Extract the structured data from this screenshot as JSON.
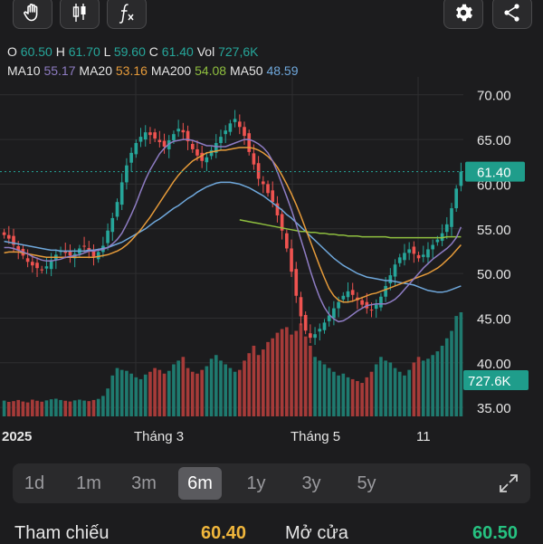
{
  "toolbar": {
    "left_buttons": [
      "hand-icon",
      "candlestick-icon",
      "function-icon"
    ],
    "right_buttons": [
      "gear-icon",
      "share-icon"
    ]
  },
  "ohlc": {
    "o_label": "O",
    "o": "60.50",
    "h_label": "H",
    "h": "61.70",
    "l_label": "L",
    "l": "59.60",
    "c_label": "C",
    "c": "61.40",
    "vol_label": "Vol",
    "vol": "727,6K"
  },
  "ma": {
    "ma10_label": "MA10",
    "ma10": "55.17",
    "ma20_label": "MA20",
    "ma20": "53.16",
    "ma200_label": "MA200",
    "ma200": "54.08",
    "ma50_label": "MA50",
    "ma50": "48.59"
  },
  "colors": {
    "up": "#26a69a",
    "down": "#ef5350",
    "ma10": "#8e7cc3",
    "ma20": "#e69b3a",
    "ma200": "#8fbf3f",
    "ma50": "#6fa8dc",
    "background": "#1c1c1e"
  },
  "chart_data": {
    "type": "candlestick",
    "y_ticks": [
      "70.00",
      "65.00",
      "60.00",
      "55.00",
      "50.00",
      "45.00",
      "40.00",
      "35.00"
    ],
    "ylim": [
      34,
      72
    ],
    "x_ticks": [
      "2025",
      "Tháng 3",
      "Tháng 5",
      "11"
    ],
    "last_price": "61.40",
    "last_volume": "727.6K",
    "close": [
      54.3,
      53.9,
      53.2,
      52.6,
      52.0,
      51.3,
      50.9,
      50.6,
      50.4,
      50.8,
      51.5,
      52.1,
      52.6,
      52.3,
      52.0,
      52.2,
      52.8,
      53.0,
      52.5,
      51.9,
      52.4,
      53.1,
      54.8,
      56.2,
      58.0,
      60.2,
      62.1,
      63.5,
      64.6,
      65.3,
      65.8,
      65.5,
      65.1,
      64.7,
      64.2,
      64.9,
      65.6,
      66.2,
      65.8,
      64.8,
      63.9,
      63.2,
      62.6,
      63.0,
      63.8,
      64.6,
      65.3,
      66.0,
      66.8,
      67.3,
      66.4,
      65.4,
      63.6,
      62.2,
      60.6,
      60.0,
      59.0,
      58.0,
      56.5,
      54.8,
      52.8,
      50.2,
      47.5,
      45.2,
      43.6,
      42.8,
      43.2,
      43.8,
      44.5,
      45.3,
      46.1,
      46.8,
      47.5,
      48.0,
      47.6,
      47.0,
      46.5,
      46.1,
      45.9,
      46.5,
      47.4,
      48.6,
      49.8,
      51.0,
      51.8,
      52.3,
      52.7,
      52.2,
      51.7,
      52.1,
      52.7,
      53.2,
      53.8,
      54.5,
      55.5,
      57.3,
      59.5,
      61.4
    ],
    "ma10": [
      52.9,
      52.9,
      52.8,
      52.6,
      52.4,
      52.2,
      51.9,
      51.7,
      51.5,
      51.4,
      51.4,
      51.5,
      51.6,
      51.8,
      51.9,
      52.0,
      52.1,
      52.3,
      52.5,
      52.5,
      52.6,
      52.7,
      52.9,
      53.3,
      53.8,
      54.5,
      55.5,
      56.6,
      57.8,
      59.2,
      60.5,
      61.6,
      62.5,
      63.4,
      64.0,
      64.5,
      64.8,
      64.9,
      65.0,
      65.0,
      64.9,
      64.7,
      64.5,
      64.3,
      64.3,
      64.2,
      64.2,
      64.2,
      64.4,
      64.6,
      64.8,
      65.0,
      65.0,
      64.8,
      64.5,
      64.1,
      63.5,
      62.6,
      61.4,
      60.0,
      58.6,
      57.1,
      55.5,
      53.8,
      52.1,
      50.3,
      48.7,
      47.3,
      46.2,
      45.4,
      44.9,
      44.6,
      44.7,
      45.0,
      45.4,
      45.8,
      46.1,
      46.4,
      46.5,
      46.6,
      46.6,
      46.6,
      46.8,
      47.1,
      47.6,
      48.2,
      48.8,
      49.4,
      50.0,
      50.6,
      51.1,
      51.6,
      52.0,
      52.4,
      52.8,
      53.3,
      54.0,
      55.2
    ],
    "ma20": [
      52.3,
      52.4,
      52.4,
      52.4,
      52.3,
      52.2,
      52.1,
      52.0,
      51.9,
      51.8,
      51.8,
      51.8,
      51.8,
      51.8,
      51.8,
      51.8,
      51.8,
      51.8,
      51.8,
      51.8,
      51.9,
      52.0,
      52.1,
      52.3,
      52.5,
      52.8,
      53.2,
      53.7,
      54.3,
      54.9,
      55.6,
      56.3,
      57.1,
      57.9,
      58.7,
      59.5,
      60.3,
      61.0,
      61.6,
      62.1,
      62.6,
      62.9,
      63.2,
      63.5,
      63.6,
      63.7,
      63.8,
      63.8,
      63.9,
      64.0,
      64.1,
      64.1,
      64.1,
      64.0,
      63.8,
      63.5,
      63.1,
      62.6,
      61.9,
      61.0,
      60.0,
      58.9,
      57.7,
      56.4,
      55.0,
      53.6,
      52.2,
      50.8,
      49.5,
      48.3,
      47.5,
      47.0,
      46.8,
      46.8,
      46.9,
      47.1,
      47.3,
      47.5,
      47.7,
      47.8,
      48.0,
      48.2,
      48.4,
      48.6,
      48.8,
      49.0,
      49.2,
      49.4,
      49.6,
      49.8,
      50.0,
      50.3,
      50.6,
      51.0,
      51.5,
      52.0,
      52.6,
      53.2
    ],
    "ma50": [
      53.6,
      53.5,
      53.4,
      53.3,
      53.2,
      53.1,
      53.0,
      52.9,
      52.8,
      52.7,
      52.6,
      52.6,
      52.5,
      52.5,
      52.5,
      52.5,
      52.5,
      52.5,
      52.6,
      52.6,
      52.7,
      52.8,
      52.9,
      53.1,
      53.3,
      53.5,
      53.8,
      54.1,
      54.4,
      54.7,
      55.0,
      55.4,
      55.8,
      56.1,
      56.5,
      56.9,
      57.3,
      57.6,
      58.0,
      58.4,
      58.7,
      59.1,
      59.4,
      59.7,
      59.9,
      60.1,
      60.2,
      60.2,
      60.2,
      60.1,
      60.0,
      59.8,
      59.6,
      59.3,
      59.0,
      58.7,
      58.3,
      57.9,
      57.5,
      57.1,
      56.6,
      56.2,
      55.7,
      55.2,
      54.7,
      54.2,
      53.7,
      53.2,
      52.7,
      52.2,
      51.7,
      51.3,
      50.9,
      50.6,
      50.3,
      50.0,
      49.8,
      49.6,
      49.5,
      49.4,
      49.3,
      49.2,
      49.2,
      49.1,
      49.0,
      48.9,
      48.8,
      48.7,
      48.5,
      48.3,
      48.1,
      48.0,
      47.9,
      47.9,
      48.0,
      48.2,
      48.4,
      48.6
    ],
    "ma200_start_index": 50,
    "ma200": [
      56.0,
      55.9,
      55.8,
      55.7,
      55.6,
      55.5,
      55.4,
      55.3,
      55.2,
      55.1,
      55.0,
      54.9,
      54.8,
      54.7,
      54.7,
      54.6,
      54.6,
      54.5,
      54.5,
      54.4,
      54.4,
      54.3,
      54.3,
      54.2,
      54.2,
      54.2,
      54.1,
      54.1,
      54.1,
      54.1,
      54.1,
      54.1,
      54.0,
      54.0,
      54.0,
      54.0,
      54.0,
      54.0,
      54.0,
      54.0,
      54.0,
      54.0,
      54.0,
      54.0,
      54.1,
      54.1,
      54.1,
      54.1
    ],
    "volume": [
      85,
      78,
      82,
      88,
      80,
      75,
      90,
      84,
      79,
      86,
      92,
      95,
      88,
      84,
      80,
      86,
      90,
      85,
      82,
      88,
      94,
      110,
      150,
      220,
      260,
      250,
      245,
      230,
      210,
      200,
      225,
      240,
      260,
      250,
      230,
      245,
      280,
      300,
      320,
      260,
      240,
      230,
      250,
      270,
      310,
      330,
      300,
      280,
      260,
      240,
      250,
      300,
      340,
      380,
      330,
      360,
      400,
      420,
      450,
      470,
      480,
      440,
      460,
      500,
      430,
      380,
      320,
      300,
      280,
      260,
      240,
      220,
      230,
      210,
      200,
      190,
      180,
      210,
      240,
      280,
      320,
      300,
      290,
      260,
      240,
      220,
      250,
      290,
      320,
      300,
      310,
      330,
      350,
      380,
      420,
      460,
      540,
      560
    ]
  },
  "timeframes": {
    "items": [
      "1d",
      "1m",
      "3m",
      "6m",
      "1y",
      "3y",
      "5y"
    ],
    "active": "6m"
  },
  "summary": {
    "ref_label": "Tham chiếu",
    "ref_value": "60.40",
    "open_label": "Mở cửa",
    "open_value": "60.50",
    "ref_color": "#f0b63c",
    "open_color": "#26c281"
  }
}
